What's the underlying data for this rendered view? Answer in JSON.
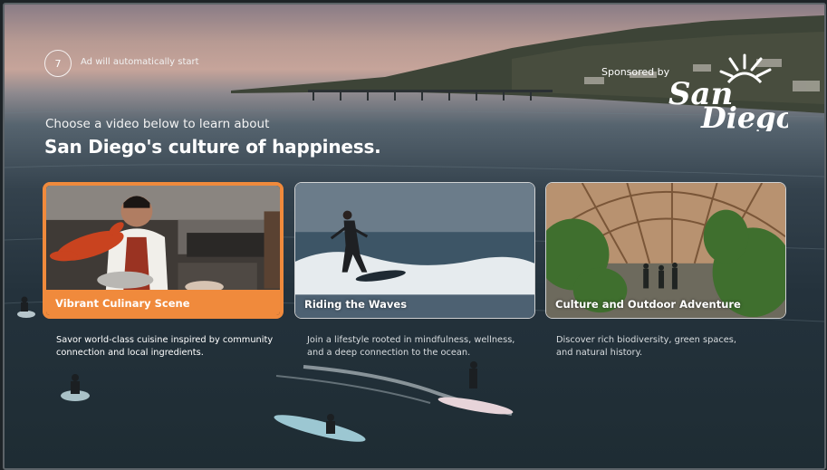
{
  "countdown": {
    "seconds": "7",
    "message": "Ad will automatically start"
  },
  "sponsor": {
    "label": "Sponsored by",
    "logo_line1": "San",
    "logo_line2": "Diego"
  },
  "intro": "Choose a video below to learn about",
  "headline": "San Diego's culture of happiness.",
  "cards": [
    {
      "title": "Vibrant Culinary Scene",
      "description": "Savor world-class cuisine inspired by community connection and local ingredients.",
      "selected": true
    },
    {
      "title": "Riding the Waves",
      "description": "Join a lifestyle rooted in mindfulness, wellness, and a deep connection to the ocean.",
      "selected": false
    },
    {
      "title": "Culture and Outdoor Adventure",
      "description": "Discover rich biodiversity, green spaces, and natural history.",
      "selected": false
    }
  ],
  "colors": {
    "accent": "#f08a3c",
    "text": "#ffffff"
  }
}
